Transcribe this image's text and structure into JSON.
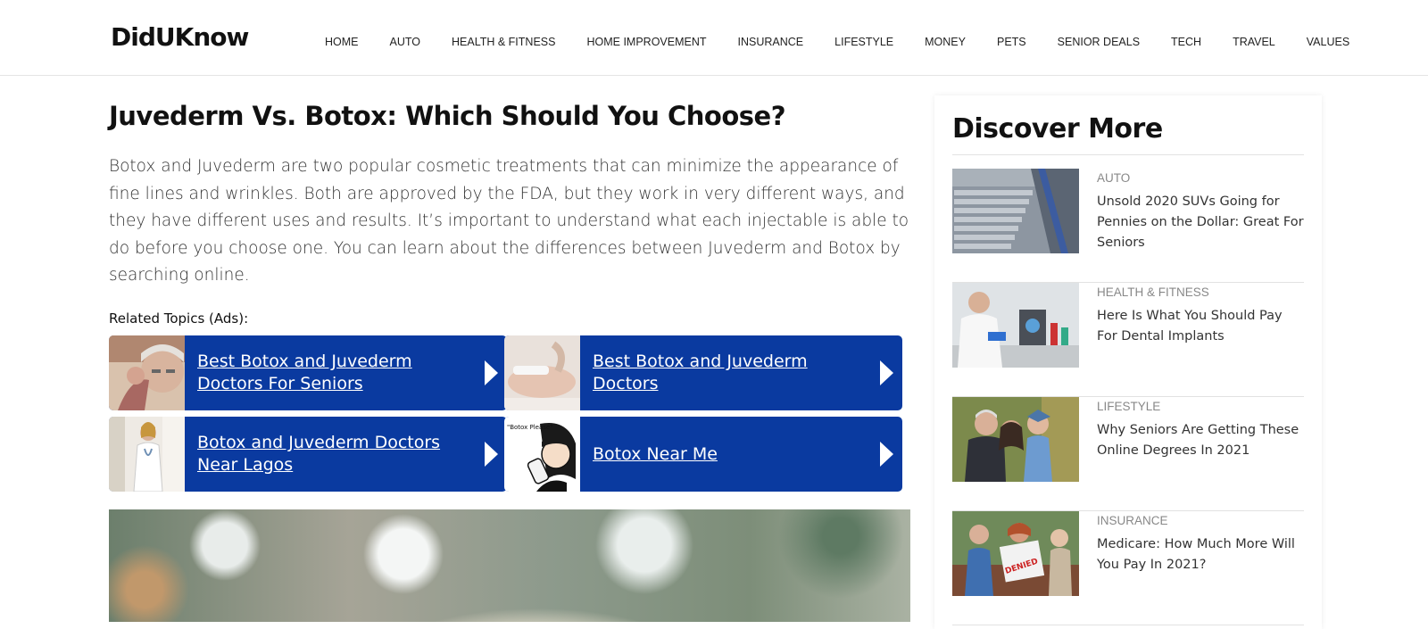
{
  "site": {
    "logo": "DidUKnow"
  },
  "nav": [
    "HOME",
    "AUTO",
    "HEALTH & FITNESS",
    "HOME IMPROVEMENT",
    "INSURANCE",
    "LIFESTYLE",
    "MONEY",
    "PETS",
    "SENIOR DEALS",
    "TECH",
    "TRAVEL",
    "VALUES"
  ],
  "article": {
    "title": "Juvederm Vs. Botox: Which Should You Choose?",
    "intro": "Botox and Juvederm are two popular cosmetic treatments that can minimize the appearance of fine lines and wrinkles. Both are approved by the FDA, but they work in very different ways, and they have different uses and results. It’s important to understand what each injectable is able to do before you choose one. You can learn about the differences between Juvederm and Botox by searching online.",
    "related_label": "Related Topics (Ads):",
    "ads": [
      {
        "label": "Best Botox and Juvederm Doctors For Seniors"
      },
      {
        "label": "Best Botox and Juvederm Doctors"
      },
      {
        "label": "Botox and Juvederm Doctors Near Lagos"
      },
      {
        "label": "Botox Near Me"
      }
    ],
    "ad_thumb_text": "\"Botox Please\""
  },
  "sidebar": {
    "title": "Discover More",
    "stories": [
      {
        "category": "AUTO",
        "headline": "Unsold 2020 SUVs Going for Pennies on the Dollar: Great For Seniors"
      },
      {
        "category": "HEALTH & FITNESS",
        "headline": "Here Is What You Should Pay For Dental Implants"
      },
      {
        "category": "LIFESTYLE",
        "headline": "Why Seniors Are Getting These Online Degrees In 2021"
      },
      {
        "category": "INSURANCE",
        "headline": "Medicare: How Much More Will You Pay In 2021?"
      }
    ],
    "denied_stamp": "DENIED"
  },
  "colors": {
    "ad_blue": "#0a3aa0",
    "text": "#333333",
    "category_gray": "#888888"
  }
}
